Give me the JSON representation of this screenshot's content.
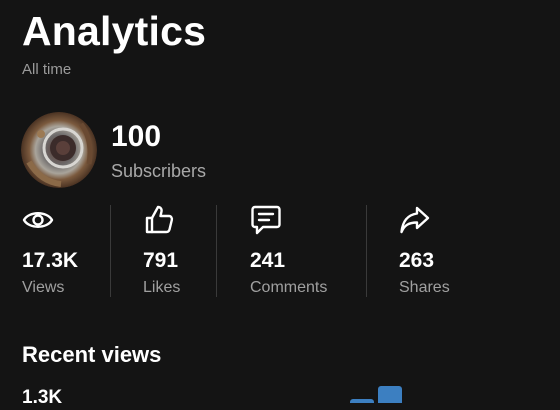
{
  "header": {
    "title": "Analytics",
    "subtitle": "All time"
  },
  "profile": {
    "subscriber_count": "100",
    "subscriber_label": "Subscribers"
  },
  "stats": [
    {
      "icon": "eye-icon",
      "value": "17.3K",
      "label": "Views"
    },
    {
      "icon": "thumbs-up-icon",
      "value": "791",
      "label": "Likes"
    },
    {
      "icon": "comment-icon",
      "value": "241",
      "label": "Comments"
    },
    {
      "icon": "share-icon",
      "value": "263",
      "label": "Shares"
    }
  ],
  "recent_views": {
    "title": "Recent views",
    "value": "1.3K"
  },
  "colors": {
    "background": "#141414",
    "text": "#ffffff",
    "muted_text": "#a0a0a0",
    "bar": "#3c7fc1"
  }
}
